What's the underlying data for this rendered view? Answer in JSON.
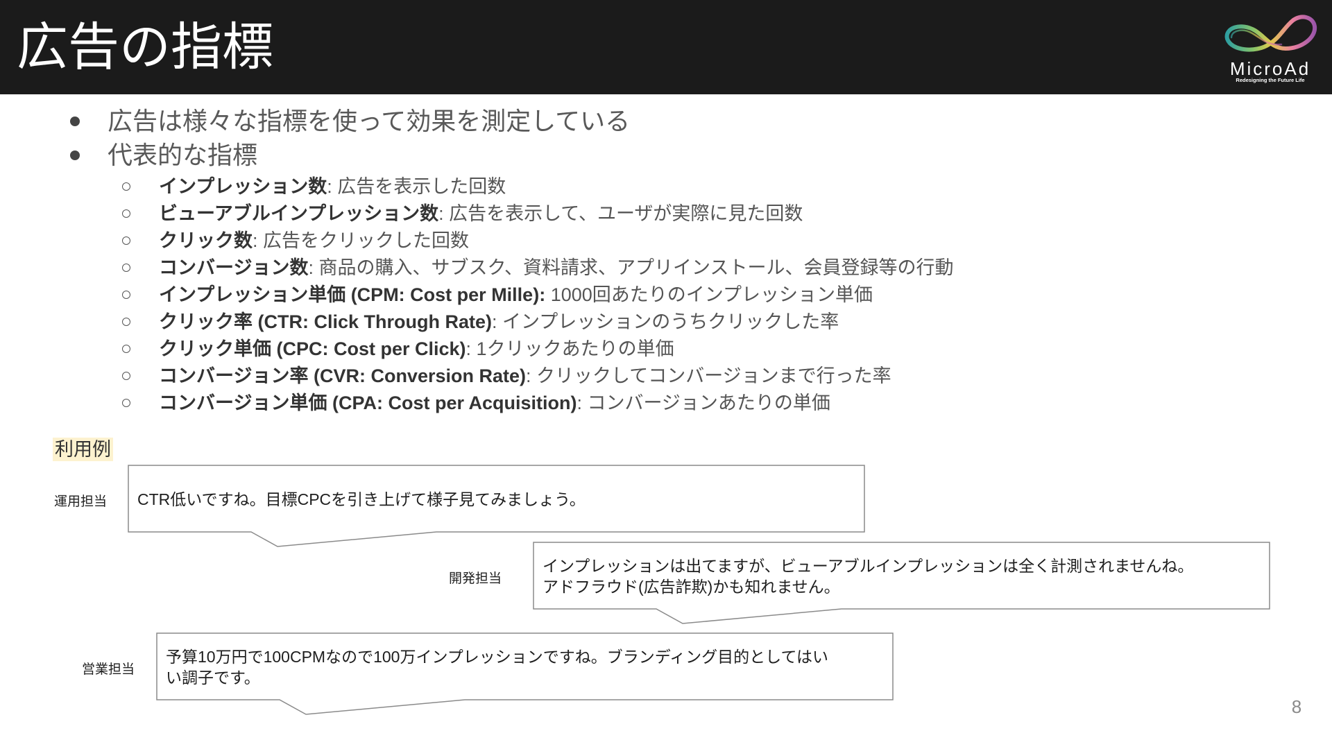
{
  "header": {
    "title": "広告の指標"
  },
  "logo": {
    "icon": "infinity-swirl-logo",
    "name": "MicroAd",
    "tagline": "Redesigning the Future Life",
    "gradient": [
      "#2f9fa0",
      "#86c46a",
      "#e0c94c",
      "#e97fa0",
      "#9b55aa"
    ]
  },
  "bullets": [
    "広告は様々な指標を使って効果を測定している",
    "代表的な指標"
  ],
  "metrics": [
    {
      "term": "インプレッション数",
      "desc": ": 広告を表示した回数"
    },
    {
      "term": "ビューアブルインプレッション数",
      "desc": ": 広告を表示して、ユーザが実際に見た回数"
    },
    {
      "term": "クリック数",
      "desc": ": 広告をクリックした回数"
    },
    {
      "term": "コンバージョン数",
      "desc": ": 商品の購入、サブスク、資料請求、アプリインストール、会員登録等の行動"
    },
    {
      "term": "インプレッション単価 (CPM: Cost per Mille):",
      "desc": " 1000回あたりのインプレッション単価"
    },
    {
      "term": "クリック率 (CTR: Click Through Rate)",
      "desc": ": インプレッションのうちクリックした率"
    },
    {
      "term": "クリック単価 (CPC: Cost per Click)",
      "desc": ": 1クリックあたりの単価"
    },
    {
      "term": "コンバージョン率 (CVR: Conversion Rate)",
      "desc": ": クリックしてコンバージョンまで行った率"
    },
    {
      "term": "コンバージョン単価 (CPA: Cost per Acquisition)",
      "desc": ": コンバージョンあたりの単価"
    }
  ],
  "example": {
    "heading": "利用例",
    "dialogs": [
      {
        "speaker": "運用担当",
        "lines": [
          "CTR低いですね。目標CPCを引き上げて様子見てみましょう。"
        ]
      },
      {
        "speaker": "開発担当",
        "lines": [
          "インプレッションは出てますが、ビューアブルインプレッションは全く計測されませんね。",
          "アドフラウド(広告詐欺)かも知れません。"
        ]
      },
      {
        "speaker": "営業担当",
        "lines": [
          "予算10万円で100CPMなので100万インプレッションですね。ブランディング目的としてはい",
          "い調子です。"
        ]
      }
    ]
  },
  "page_number": "8",
  "colors": {
    "header_bg": "#1b1b1b",
    "title": "#ffffff",
    "highlight": "#fdf2cf",
    "bubble_border": "#8a8a8a",
    "page_num": "#8a8a8a"
  }
}
